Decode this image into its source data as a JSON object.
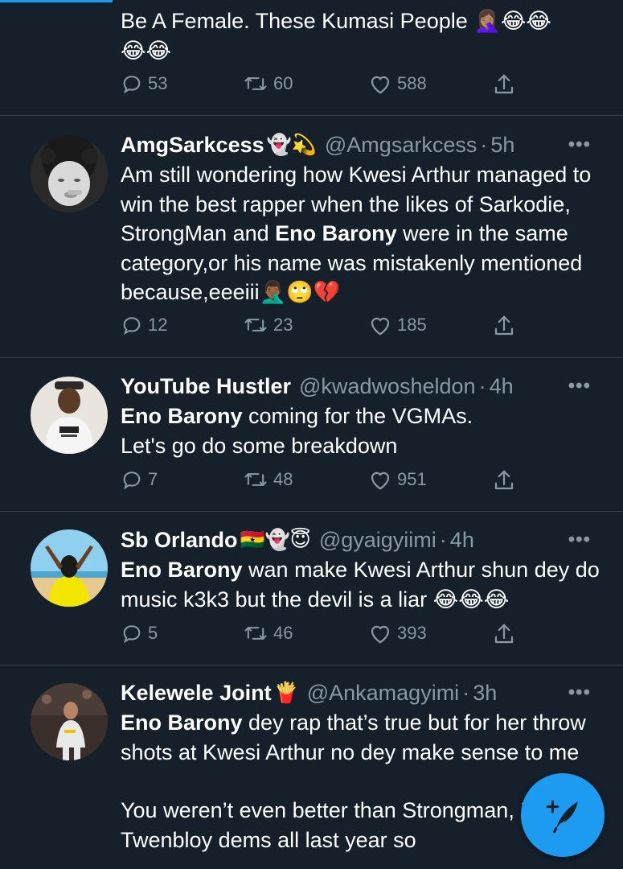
{
  "tweets": [
    {
      "text_lines": [
        "Be A Female. These Kumasi People 🤦🏽‍♀️😂😂",
        "😂😂"
      ],
      "replies": "53",
      "retweets": "60",
      "likes": "588"
    },
    {
      "name": "AmgSarkcess",
      "name_emoji": "👻💫",
      "handle": "@Amgsarkcess",
      "time": "5h",
      "text_parts": {
        "a": "Am still wondering how Kwesi Arthur managed to win the best rapper when the likes of Sarkodie, StrongMan and ",
        "mention": "Eno Barony",
        "b": " were in the same category,or his name was mistakenly mentioned because,eeeiii🤦🏾‍♂️🙄💔"
      },
      "replies": "12",
      "retweets": "23",
      "likes": "185"
    },
    {
      "name": "YouTube Hustler",
      "name_emoji": "",
      "handle": "@kwadwosheldon",
      "time": "4h",
      "text_parts": {
        "mention": "Eno Barony",
        "a": " coming for the VGMAs.",
        "b": "Let's go do some breakdown"
      },
      "replies": "7",
      "retweets": "48",
      "likes": "951"
    },
    {
      "name": "Sb Orlando",
      "name_emoji": "🇬🇭👻😇",
      "handle": "@gyaigyiimi",
      "time": "4h",
      "text_parts": {
        "mention": "Eno Barony",
        "a": " wan make Kwesi Arthur shun dey do music k3k3 but the devil is a liar 😂😂😂"
      },
      "replies": "5",
      "retweets": "46",
      "likes": "393"
    },
    {
      "name": "Kelewele Joint",
      "name_emoji": "🍟",
      "handle": "@Ankamagyimi",
      "time": "3h",
      "text_parts": {
        "mention": "Eno Barony",
        "a": " dey rap that’s true but for her throw shots at Kwesi Arthur no dey make sense to me",
        "b": "You weren’t even better than Strongman, Medikal, Twenbloy dems all last year so"
      }
    }
  ],
  "more_label": "•••",
  "dot": "·",
  "colors": {
    "background": "#15202b",
    "secondary_text": "#8899a6",
    "divider": "#38444d",
    "accent": "#1d9bf0"
  },
  "icons": [
    "reply-icon",
    "retweet-icon",
    "like-icon",
    "share-icon",
    "compose-tweet-icon"
  ]
}
